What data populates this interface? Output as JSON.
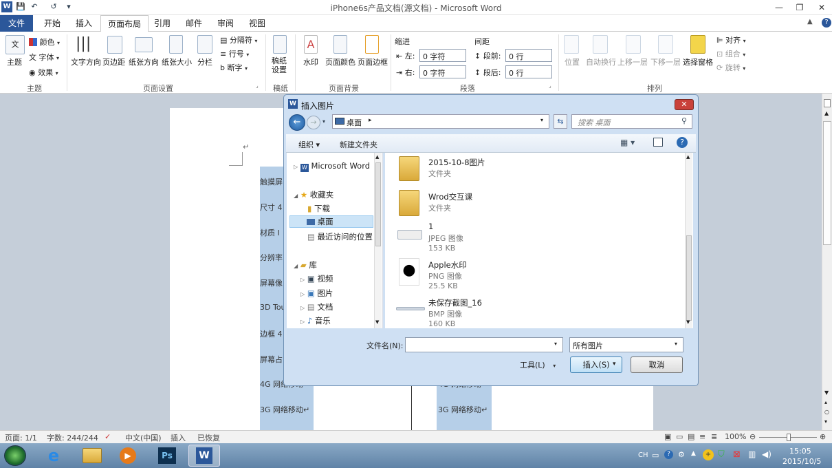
{
  "window": {
    "title": "iPhone6s产品文档(源文档) - Microsoft Word",
    "min": "—",
    "restore": "❐",
    "close": "✕"
  },
  "qat": {
    "save": "💾",
    "undo": "↶",
    "redo": "↺",
    "customize": "▾"
  },
  "tabs": [
    "文件",
    "开始",
    "插入",
    "页面布局",
    "引用",
    "邮件",
    "审阅",
    "视图"
  ],
  "ribbon": {
    "theme": {
      "theme_label": "主题",
      "colors": "颜色",
      "fonts": "字体",
      "effects": "效果",
      "group": "主题"
    },
    "page_setup": {
      "text_direction": "文字方向",
      "margins": "页边距",
      "orientation": "纸张方向",
      "size": "纸张大小",
      "columns": "分栏",
      "breaks": "分隔符",
      "line_numbers": "行号",
      "hyphenation": "断字",
      "group": "页面设置"
    },
    "draft": {
      "label": "稿纸\n设置",
      "group": "稿纸"
    },
    "page_bg": {
      "watermark": "水印",
      "page_color": "页面颜色",
      "page_borders": "页面边框",
      "group": "页面背景"
    },
    "paragraph": {
      "indent_title": "缩进",
      "left": "左:",
      "left_val": "0 字符",
      "right": "右:",
      "right_val": "0 字符",
      "spacing_title": "间距",
      "before": "段前:",
      "before_val": "0 行",
      "after": "段后:",
      "after_val": "0 行",
      "group": "段落"
    },
    "arrange": {
      "position": "位置",
      "wrap": "自动换行",
      "forward": "上移一层",
      "backward": "下移一层",
      "pane": "选择窗格",
      "align": "对齐",
      "group_btn": "组合",
      "rotate": "旋转",
      "group": "排列"
    }
  },
  "document": {
    "mark": "↵",
    "rows": [
      "触摸屏",
      "尺寸 4",
      "材质 I",
      "分辨率",
      "屏幕像",
      "3D Tou",
      "边框 4",
      "屏幕占",
      "4G 网络移动",
      "3G 网络移动↵"
    ],
    "right_row_1": "4G 网络移动",
    "right_row_2": "3G 网络移动↵"
  },
  "dialog": {
    "title": "插入图片",
    "address": "桌面",
    "search_placeholder": "搜索 桌面",
    "organize": "组织 ▾",
    "new_folder": "新建文件夹",
    "nav": [
      {
        "label": "Microsoft Word"
      },
      {
        "label": "收藏夹"
      },
      {
        "label": "下载"
      },
      {
        "label": "桌面"
      },
      {
        "label": "最近访问的位置"
      },
      {
        "label": "库"
      },
      {
        "label": "视频"
      },
      {
        "label": "图片"
      },
      {
        "label": "文档"
      },
      {
        "label": "音乐"
      }
    ],
    "files": [
      {
        "name": "2015-10-8图片",
        "type": "文件夹",
        "size": ""
      },
      {
        "name": "Wrod交互课",
        "type": "文件夹",
        "size": ""
      },
      {
        "name": "1",
        "type": "JPEG 图像",
        "size": "153 KB"
      },
      {
        "name": "Apple水印",
        "type": "PNG 图像",
        "size": "25.5 KB"
      },
      {
        "name": "未保存截图_16",
        "type": "BMP 图像",
        "size": "160 KB"
      }
    ],
    "filename_label": "文件名(N):",
    "filename_value": "",
    "filetype": "所有图片",
    "tools": "工具(L)",
    "insert": "插入(S)",
    "cancel": "取消"
  },
  "status": {
    "page": "页面: 1/1",
    "words": "字数: 244/244",
    "lang": "中文(中国)",
    "insert_mode": "插入",
    "recovered": "已恢复",
    "zoom": "100%"
  },
  "taskbar": {
    "ime": "CH",
    "time": "15:05",
    "date": "2015/10/5"
  }
}
